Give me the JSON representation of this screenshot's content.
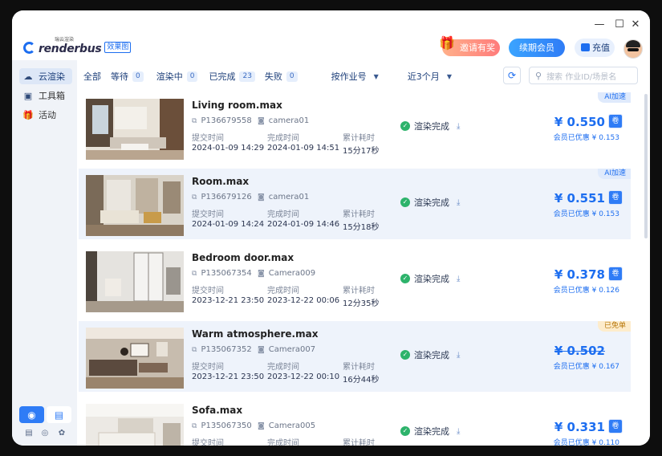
{
  "app": {
    "logo_small": "瑞云渲染",
    "logo_name": "renderbus",
    "logo_tag": "效果图"
  },
  "window_controls": {
    "minimize": "—",
    "maximize": "☐",
    "close": "✕"
  },
  "header": {
    "invite": "邀请有奖",
    "renew": "续期会员",
    "recharge": "充值"
  },
  "sidebar": {
    "items": [
      {
        "label": "云渲染",
        "icon": "cloud-icon",
        "glyph": "☁"
      },
      {
        "label": "工具箱",
        "icon": "toolbox-icon",
        "glyph": "▣"
      },
      {
        "label": "活动",
        "icon": "gift-icon",
        "glyph": "🎁"
      }
    ],
    "bottom": {
      "btn1": "◉",
      "btn2": "▤",
      "mini1": "▤",
      "mini2": "◎",
      "mini3": "✿"
    }
  },
  "filters": {
    "all": "全部",
    "waiting": "等待",
    "waiting_count": "0",
    "rendering": "渲染中",
    "rendering_count": "0",
    "done": "已完成",
    "done_count": "23",
    "failed": "失败",
    "failed_count": "0",
    "by_job": "按作业号",
    "period": "近3个月"
  },
  "search": {
    "placeholder": "搜索 作业ID/场景名"
  },
  "labels": {
    "submit": "提交时间",
    "complete": "完成时间",
    "elapsed": "累计耗时",
    "status": "渲染完成",
    "discount_prefix": "会员已优惠 "
  },
  "jobs": [
    {
      "name": "Living room.max",
      "id": "P136679558",
      "camera": "camera01",
      "submit": "2024-01-09 14:29",
      "complete": "2024-01-09 14:51",
      "elapsed": "15分17秒",
      "tag": "AI加速",
      "price": "¥ 0.550",
      "discount": "会员已优惠 ¥ 0.153"
    },
    {
      "name": "Room.max",
      "id": "P136679126",
      "camera": "camera01",
      "submit": "2024-01-09 14:24",
      "complete": "2024-01-09 14:46",
      "elapsed": "15分18秒",
      "tag": "AI加速",
      "price": "¥ 0.551",
      "discount": "会员已优惠 ¥ 0.153"
    },
    {
      "name": "Bedroom door.max",
      "id": "P135067354",
      "camera": "Camera009",
      "submit": "2023-12-21 23:50",
      "complete": "2023-12-22 00:06",
      "elapsed": "12分35秒",
      "tag": "",
      "price": "¥ 0.378",
      "discount": "会员已优惠 ¥ 0.126"
    },
    {
      "name": "Warm atmosphere.max",
      "id": "P135067352",
      "camera": "Camera007",
      "submit": "2023-12-21 23:50",
      "complete": "2023-12-22 00:10",
      "elapsed": "16分44秒",
      "tag": "已免单",
      "price": "¥ 0.502",
      "discount": "会员已优惠 ¥ 0.167"
    },
    {
      "name": "Sofa.max",
      "id": "P135067350",
      "camera": "Camera005",
      "submit": "",
      "complete": "",
      "elapsed": "",
      "tag": "",
      "price": "¥ 0.331",
      "discount": "会员已优惠 ¥ 0.110"
    }
  ]
}
